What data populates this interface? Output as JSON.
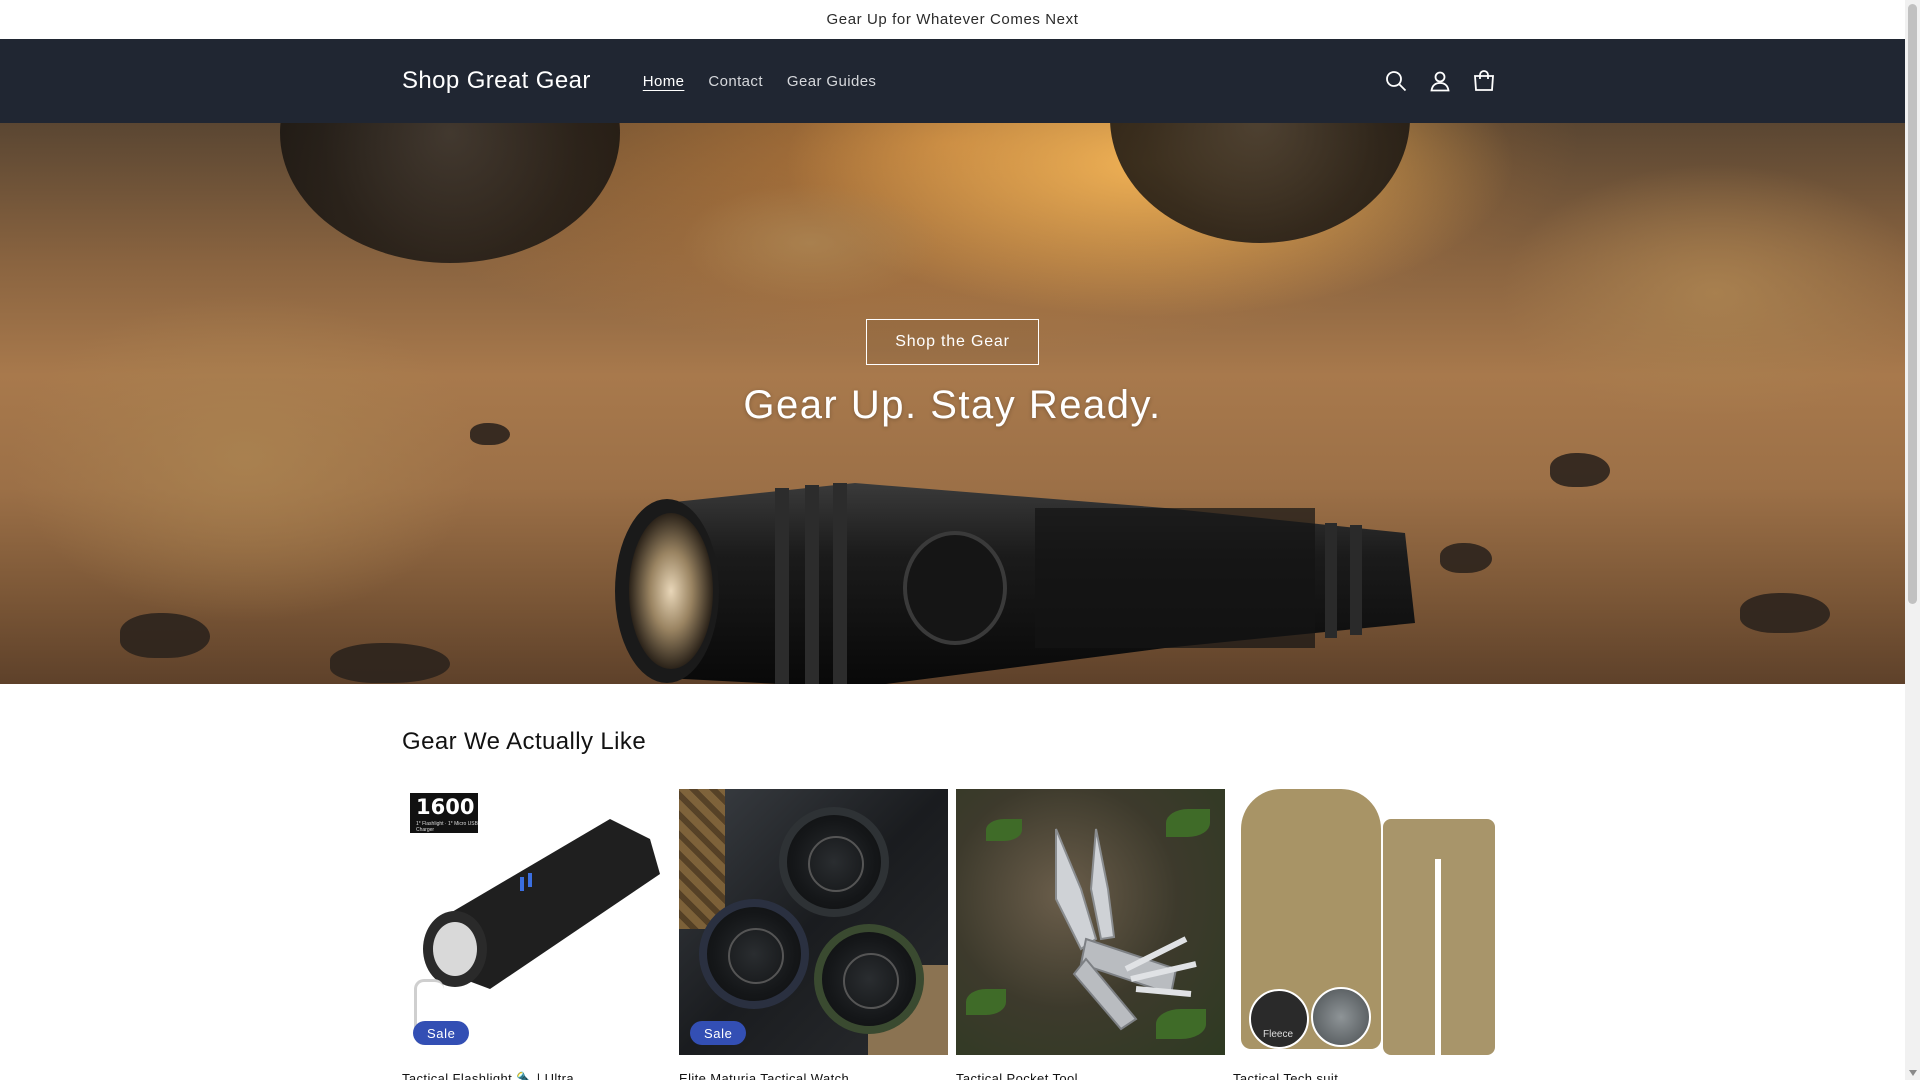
{
  "announcement": {
    "text": "Gear Up for Whatever Comes Next"
  },
  "header": {
    "logo": "Shop Great Gear",
    "nav": [
      {
        "label": "Home",
        "active": true
      },
      {
        "label": "Contact",
        "active": false
      },
      {
        "label": "Gear Guides",
        "active": false
      }
    ],
    "icons": [
      "search-icon",
      "account-icon",
      "cart-icon"
    ]
  },
  "hero": {
    "button_label": "Shop the Gear",
    "title": "Gear Up. Stay Ready."
  },
  "featured": {
    "title": "Gear We Actually Like",
    "products": [
      {
        "title": "Tactical Flashlight 🔦 | Ultra",
        "badge": "Sale",
        "box_text": "1600",
        "box_subtext": "1* Flashlight · 1* Micro USB Charger"
      },
      {
        "title": "Elite Maturia Tactical Watch",
        "badge": "Sale"
      },
      {
        "title": "Tactical Pocket Tool",
        "badge": ""
      },
      {
        "title": "Tactical Tech suit",
        "badge": "",
        "swatch_label": "Fleece"
      }
    ]
  },
  "colors": {
    "header_bg": "#202632",
    "badge_bg": "#334fb4",
    "text": "#121212"
  }
}
